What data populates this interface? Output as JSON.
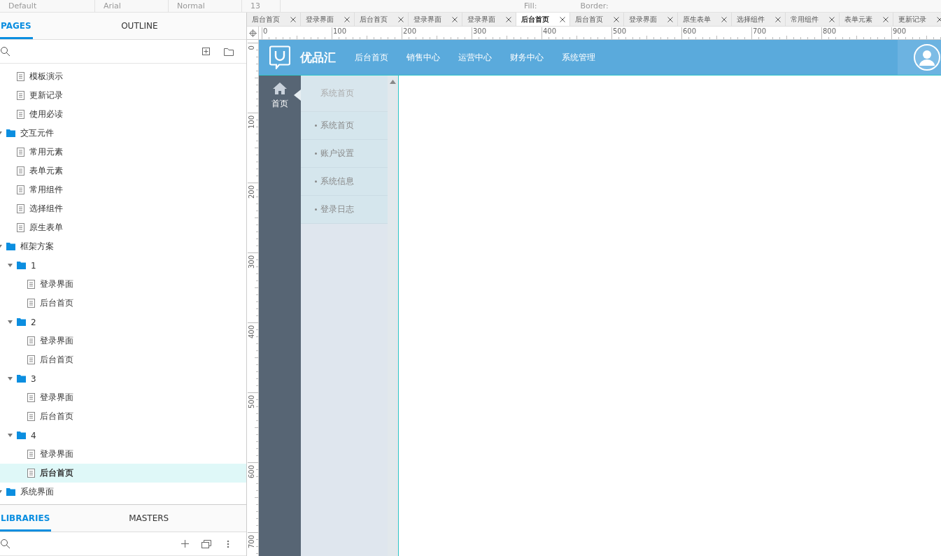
{
  "toolbar": {
    "font_style": "Default",
    "font_family": "Arial",
    "font_weight": "Normal",
    "font_size": "13",
    "fill_label": "Fill:",
    "border_label": "Border:"
  },
  "left_panel": {
    "tabs": [
      {
        "label": "PAGES",
        "selected": true
      },
      {
        "label": "OUTLINE",
        "selected": false
      }
    ],
    "tree": [
      {
        "kind": "page",
        "label": "模板演示",
        "selected": false
      },
      {
        "kind": "page",
        "label": "更新记录",
        "selected": false
      },
      {
        "kind": "page",
        "label": "使用必读",
        "selected": false
      },
      {
        "kind": "folder",
        "label": "交互元件",
        "expanded": true,
        "children": [
          {
            "kind": "page",
            "label": "常用元素",
            "selected": false
          },
          {
            "kind": "page",
            "label": "表单元素",
            "selected": false
          },
          {
            "kind": "page",
            "label": "常用组件",
            "selected": false
          },
          {
            "kind": "page",
            "label": "选择组件",
            "selected": false
          },
          {
            "kind": "page",
            "label": "原生表单",
            "selected": false
          }
        ]
      },
      {
        "kind": "folder",
        "label": "框架方案",
        "expanded": true,
        "children": [
          {
            "kind": "folder",
            "label": "1",
            "expanded": true,
            "children": [
              {
                "kind": "page",
                "label": "登录界面",
                "selected": false
              },
              {
                "kind": "page",
                "label": "后台首页",
                "selected": false
              }
            ]
          },
          {
            "kind": "folder",
            "label": "2",
            "expanded": true,
            "children": [
              {
                "kind": "page",
                "label": "登录界面",
                "selected": false
              },
              {
                "kind": "page",
                "label": "后台首页",
                "selected": false
              }
            ]
          },
          {
            "kind": "folder",
            "label": "3",
            "expanded": true,
            "children": [
              {
                "kind": "page",
                "label": "登录界面",
                "selected": false
              },
              {
                "kind": "page",
                "label": "后台首页",
                "selected": false
              }
            ]
          },
          {
            "kind": "folder",
            "label": "4",
            "expanded": true,
            "children": [
              {
                "kind": "page",
                "label": "登录界面",
                "selected": false
              },
              {
                "kind": "page",
                "label": "后台首页",
                "selected": true
              }
            ]
          }
        ]
      },
      {
        "kind": "folder",
        "label": "系统界面",
        "expanded": true
      }
    ],
    "bottom_tabs": [
      {
        "label": "LIBRARIES",
        "selected": true
      },
      {
        "label": "MASTERS",
        "selected": false
      }
    ]
  },
  "doc_tabs": [
    {
      "label": "后台首页",
      "selected": false
    },
    {
      "label": "登录界面",
      "selected": false
    },
    {
      "label": "后台首页",
      "selected": false
    },
    {
      "label": "登录界面",
      "selected": false
    },
    {
      "label": "登录界面",
      "selected": false
    },
    {
      "label": "后台首页",
      "selected": true
    },
    {
      "label": "后台首页",
      "selected": false
    },
    {
      "label": "登录界面",
      "selected": false
    },
    {
      "label": "原生表单",
      "selected": false
    },
    {
      "label": "选择组件",
      "selected": false
    },
    {
      "label": "常用组件",
      "selected": false
    },
    {
      "label": "表单元素",
      "selected": false
    },
    {
      "label": "更新记录",
      "selected": false
    }
  ],
  "ruler": {
    "x_labels": [
      "0",
      "100",
      "200",
      "300",
      "400",
      "500",
      "600",
      "700",
      "800",
      "900"
    ],
    "y_labels": [
      "0",
      "100",
      "200",
      "300",
      "400",
      "500",
      "600",
      "700"
    ]
  },
  "canvas": {
    "brand": "优品汇",
    "nav": [
      "后台首页",
      "销售中心",
      "运营中心",
      "财务中心",
      "系统管理"
    ],
    "side_item": "首页",
    "submenu_title": "系统首页",
    "submenu": [
      "系统首页",
      "账户设置",
      "系统信息",
      "登录日志"
    ]
  }
}
